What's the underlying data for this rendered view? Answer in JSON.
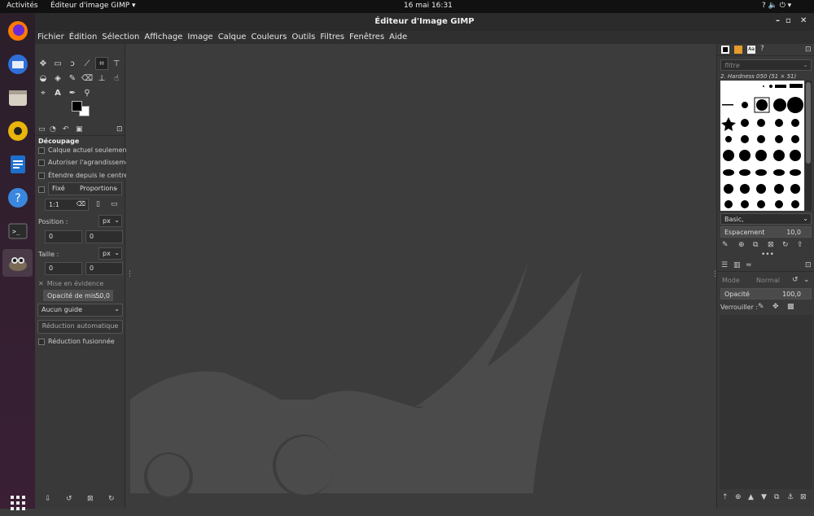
{
  "topbar": {
    "activities": "Activités",
    "app_name": "Éditeur d'image GIMP ▾",
    "clock": "16 mai  16:31",
    "sys_icons": "? 🔈 ⏻ ▾"
  },
  "window": {
    "title": "Éditeur d'Image GIMP",
    "minimize": "–",
    "restore": "▫",
    "close": "✕"
  },
  "menu": [
    "Fichier",
    "Édition",
    "Sélection",
    "Affichage",
    "Image",
    "Calque",
    "Couleurs",
    "Outils",
    "Filtres",
    "Fenêtres",
    "Aide"
  ],
  "tool_options": {
    "section_title": "Découpage",
    "current_layer_only": "Calque actuel seulement",
    "allow_growing": "Autoriser l'agrandissement",
    "expand_from_center": "Étendre depuis le centre",
    "fixed_label": "Fixé",
    "fixed_mode": "Proportions",
    "ratio_value": "1:1",
    "position_label": "Position :",
    "size_label": "Taille :",
    "unit": "px",
    "pos_x": "0",
    "pos_y": "0",
    "size_w": "0",
    "size_h": "0",
    "highlight_label": "Mise en évidence",
    "highlight_opacity_label": "Opacité de mis…",
    "highlight_opacity_value": "50,0",
    "guide_select": "Aucun guide",
    "auto_shrink": "Réduction automatique",
    "shrink_merged": "Réduction fusionnée"
  },
  "brushes": {
    "filter_placeholder": "filtre",
    "brush_name": "2. Hardness 050 (51 × 51)",
    "tag": "Basic,",
    "spacing_label": "Espacement",
    "spacing_value": "10,0"
  },
  "layers": {
    "mode_label": "Mode",
    "mode_value": "Normal",
    "opacity_label": "Opacité",
    "opacity_value": "100,0",
    "lock_label": "Verrouiller :"
  },
  "colors": {
    "accent": "#ffffff",
    "wilber": "#4b4b4b",
    "bg": "#3c3c3c"
  }
}
